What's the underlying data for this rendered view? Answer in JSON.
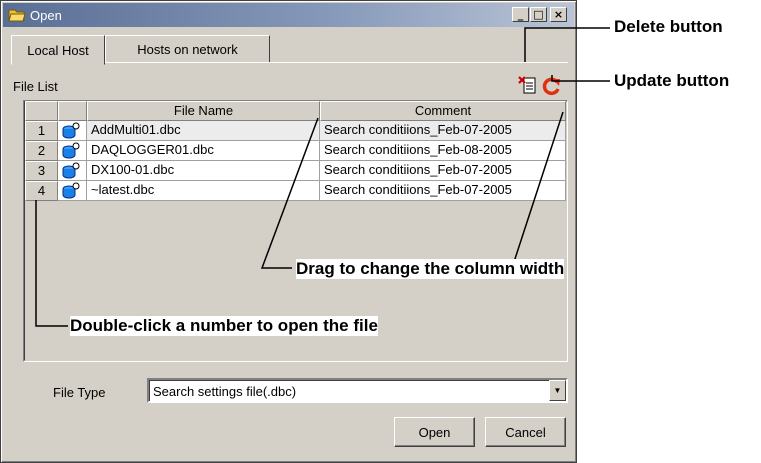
{
  "window": {
    "title": "Open",
    "controls": {
      "minimize": "_",
      "maximize": "□",
      "close": "×"
    }
  },
  "tabs": [
    {
      "label": "Local Host",
      "active": true
    },
    {
      "label": "Hosts on network",
      "active": false
    }
  ],
  "file_list": {
    "label": "File List",
    "icons": {
      "delete": "delete-icon",
      "update": "refresh-icon"
    },
    "columns": {
      "number": "",
      "icon": "",
      "name": "File Name",
      "comment": "Comment"
    },
    "rows": [
      {
        "number": "1",
        "name": "AddMulti01.dbc",
        "comment": "Search conditiions_Feb-07-2005"
      },
      {
        "number": "2",
        "name": "DAQLOGGER01.dbc",
        "comment": "Search conditiions_Feb-08-2005"
      },
      {
        "number": "3",
        "name": "DX100-01.dbc",
        "comment": "Search conditiions_Feb-07-2005"
      },
      {
        "number": "4",
        "name": "~latest.dbc",
        "comment": "Search conditiions_Feb-07-2005"
      }
    ]
  },
  "file_type": {
    "label": "File Type",
    "selected": "Search settings file(.dbc)"
  },
  "buttons": {
    "open": "Open",
    "cancel": "Cancel"
  },
  "callouts": {
    "delete": "Delete button",
    "update": "Update button",
    "column_width": "Drag to change the column width",
    "double_click": "Double-click a number to open the file"
  },
  "colors": {
    "title_bar_start": "#5a6f95",
    "face": "#d4d0c8",
    "delete_icon": "#cc0000",
    "update_icon": "#e03010"
  }
}
